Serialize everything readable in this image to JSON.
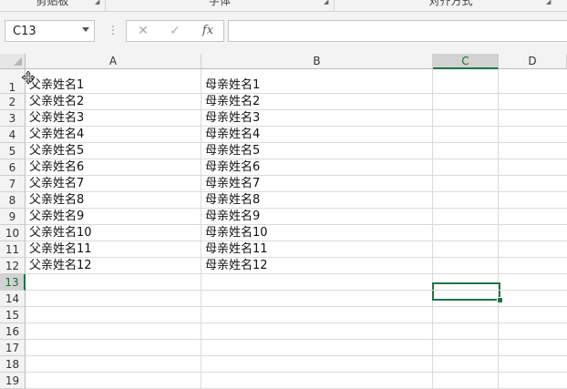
{
  "ribbon": {
    "groups": [
      {
        "label": "剪贴板"
      },
      {
        "label": "字体"
      },
      {
        "label": "对齐方式"
      }
    ]
  },
  "formula_bar": {
    "name_box": "C13",
    "cancel_icon": "close-icon",
    "enter_icon": "check-icon",
    "function_label": "fx",
    "formula": ""
  },
  "columns": [
    "A",
    "B",
    "C",
    "D"
  ],
  "selected_cell": "C13",
  "rows": [
    {
      "num": "1",
      "a": "父亲姓名1",
      "b": "母亲姓名1"
    },
    {
      "num": "2",
      "a": "父亲姓名2",
      "b": "母亲姓名2"
    },
    {
      "num": "3",
      "a": "父亲姓名3",
      "b": "母亲姓名3"
    },
    {
      "num": "4",
      "a": "父亲姓名4",
      "b": "母亲姓名4"
    },
    {
      "num": "5",
      "a": "父亲姓名5",
      "b": "母亲姓名5"
    },
    {
      "num": "6",
      "a": "父亲姓名6",
      "b": "母亲姓名6"
    },
    {
      "num": "7",
      "a": "父亲姓名7",
      "b": "母亲姓名7"
    },
    {
      "num": "8",
      "a": "父亲姓名8",
      "b": "母亲姓名8"
    },
    {
      "num": "9",
      "a": "父亲姓名9",
      "b": "母亲姓名9"
    },
    {
      "num": "10",
      "a": "父亲姓名10",
      "b": "母亲姓名10"
    },
    {
      "num": "11",
      "a": "父亲姓名11",
      "b": "母亲姓名11"
    },
    {
      "num": "12",
      "a": "父亲姓名12",
      "b": "母亲姓名12"
    },
    {
      "num": "13",
      "a": "",
      "b": ""
    },
    {
      "num": "14",
      "a": "",
      "b": ""
    },
    {
      "num": "15",
      "a": "",
      "b": ""
    },
    {
      "num": "16",
      "a": "",
      "b": ""
    },
    {
      "num": "17",
      "a": "",
      "b": ""
    },
    {
      "num": "18",
      "a": "",
      "b": ""
    },
    {
      "num": "19",
      "a": "",
      "b": ""
    }
  ],
  "colors": {
    "accent": "#217346",
    "header_bg": "#f3f3f3",
    "gridline": "#dadada"
  }
}
